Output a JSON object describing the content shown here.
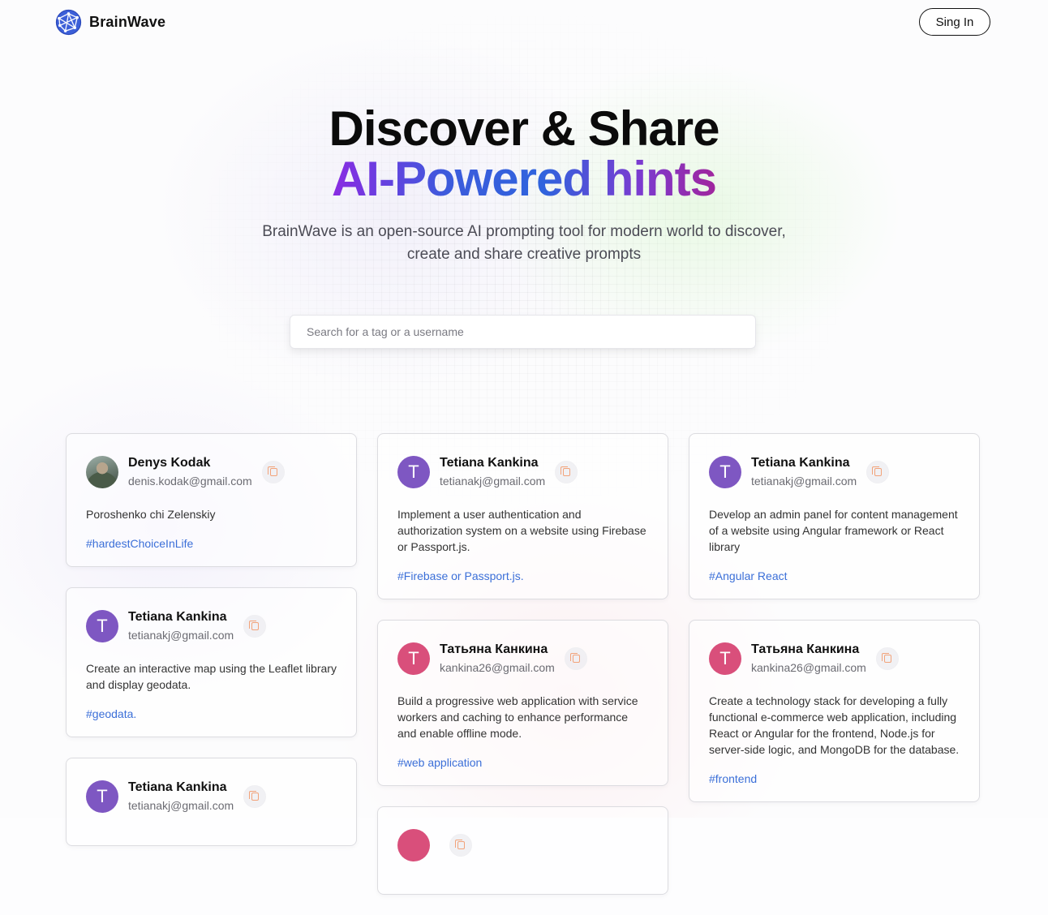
{
  "nav": {
    "brand": "BrainWave",
    "signin_label": "Sing In"
  },
  "hero": {
    "title_line1": "Discover & Share",
    "title_line2": "AI-Powered hints",
    "description": "BrainWave is an open-source AI prompting tool for modern world to discover, create and share creative prompts"
  },
  "search": {
    "placeholder": "Search for a tag or a username",
    "value": ""
  },
  "colors": {
    "accent_purple": "#7e57c2",
    "accent_pink": "#d94f7b",
    "tag_blue": "#3b6fd8",
    "copy_orange": "#f2a37a"
  },
  "columns": [
    [
      {
        "avatar_type": "photo",
        "avatar_letter": "",
        "name": "Denys Kodak",
        "email": "denis.kodak@gmail.com",
        "prompt": "Poroshenko chi Zelenskiy",
        "tag": "#hardestChoiceInLife"
      },
      {
        "avatar_type": "letter",
        "avatar_letter": "T",
        "avatar_color": "#7e57c2",
        "name": "Tetiana Kankina",
        "email": "tetianakj@gmail.com",
        "prompt": "Create an interactive map using the Leaflet library and display geodata.",
        "tag": "#geodata."
      },
      {
        "avatar_type": "letter",
        "avatar_letter": "T",
        "avatar_color": "#7e57c2",
        "name": "Tetiana Kankina",
        "email": "tetianakj@gmail.com",
        "prompt": "",
        "tag": ""
      }
    ],
    [
      {
        "avatar_type": "letter",
        "avatar_letter": "T",
        "avatar_color": "#7e57c2",
        "name": "Tetiana Kankina",
        "email": "tetianakj@gmail.com",
        "prompt": "Implement a user authentication and authorization system on a website using Firebase or Passport.js.",
        "tag": "#Firebase or Passport.js."
      },
      {
        "avatar_type": "letter",
        "avatar_letter": "T",
        "avatar_color": "#d94f7b",
        "name": "Татьяна Канкина",
        "email": "kankina26@gmail.com",
        "prompt": "Build a progressive web application with service workers and caching to enhance performance and enable offline mode.",
        "tag": "#web application"
      },
      {
        "avatar_type": "letter",
        "avatar_letter": "",
        "avatar_color": "#d94f7b",
        "name": "",
        "email": "",
        "prompt": "",
        "tag": ""
      }
    ],
    [
      {
        "avatar_type": "letter",
        "avatar_letter": "T",
        "avatar_color": "#7e57c2",
        "name": "Tetiana Kankina",
        "email": "tetianakj@gmail.com",
        "prompt": "Develop an admin panel for content management of a website using Angular framework or React library",
        "tag": "#Angular React"
      },
      {
        "avatar_type": "letter",
        "avatar_letter": "T",
        "avatar_color": "#d94f7b",
        "name": "Татьяна Канкина",
        "email": "kankina26@gmail.com",
        "prompt": "Create a technology stack for developing a fully functional e-commerce web application, including React or Angular for the frontend, Node.js for server-side logic, and MongoDB for the database.",
        "tag": "#frontend"
      }
    ]
  ]
}
